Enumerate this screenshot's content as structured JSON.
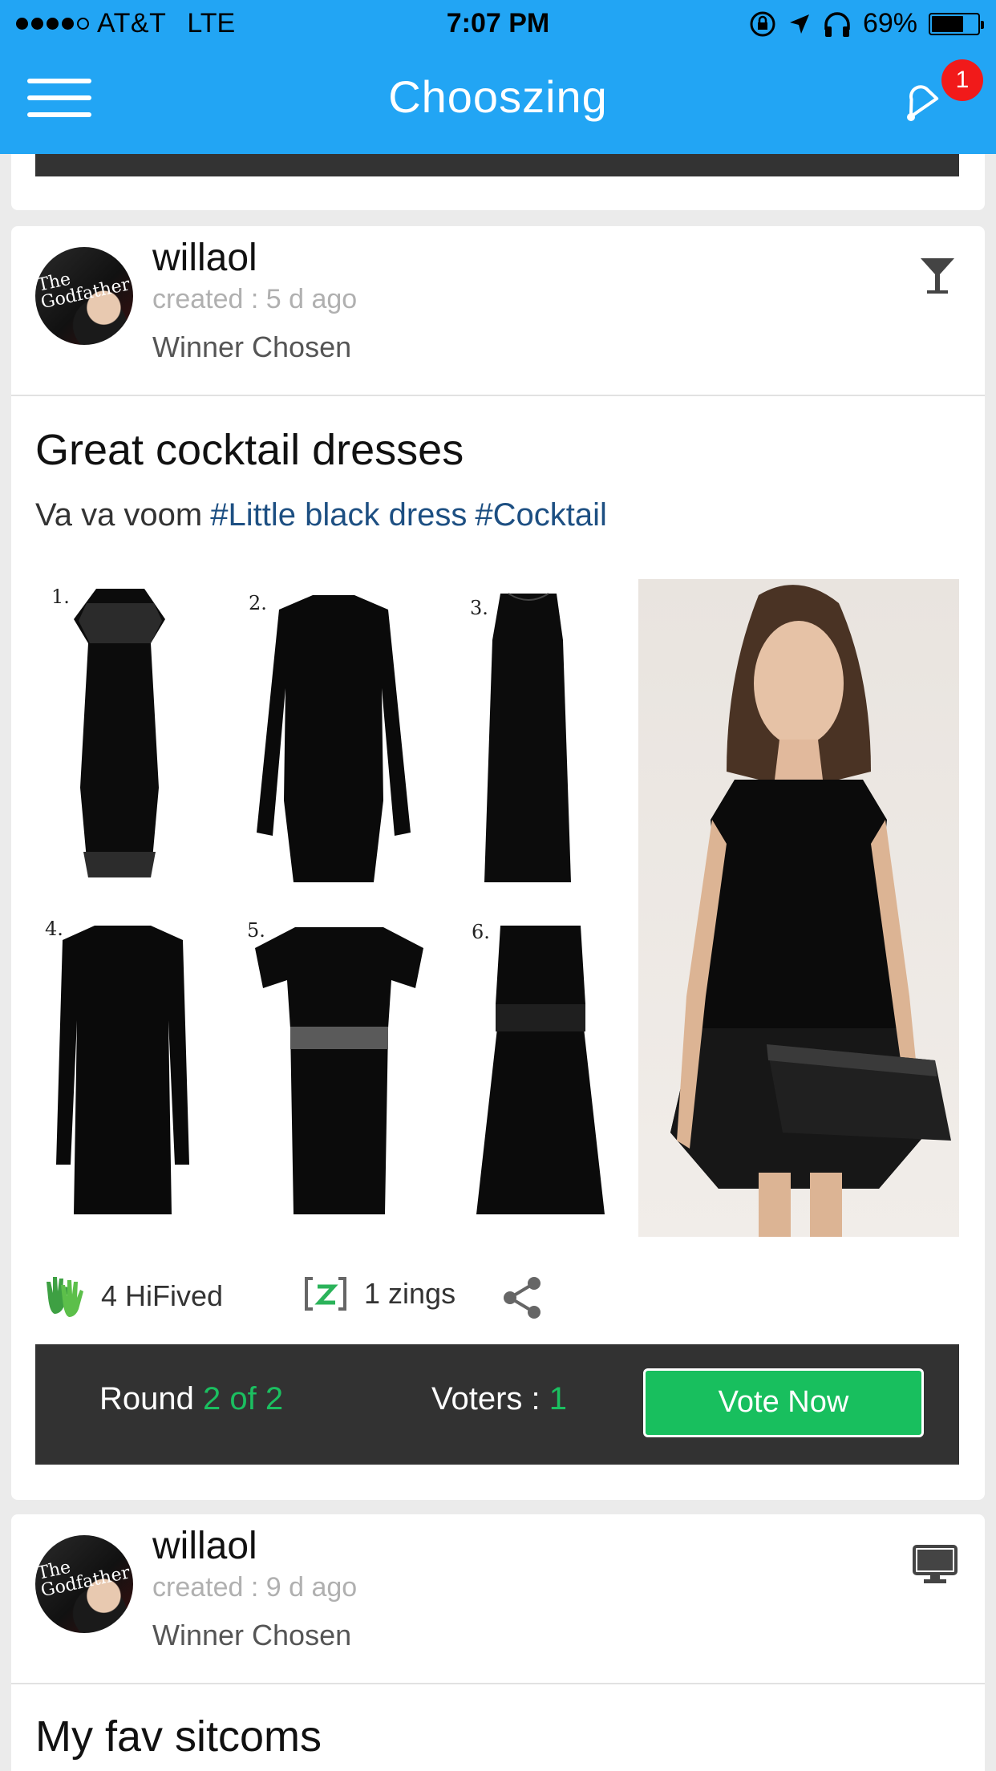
{
  "status_bar": {
    "carrier": "AT&T",
    "network": "LTE",
    "time": "7:07 PM",
    "battery": "69%",
    "battery_level": 0.69,
    "icons": [
      "orientation-lock-icon",
      "location-arrow-icon",
      "headphones-icon",
      "battery-icon"
    ]
  },
  "nav": {
    "title": "Chooszing",
    "menu_icon": "hamburger-menu-icon",
    "notification_icon": "bell-icon",
    "notification_count": "1"
  },
  "colors": {
    "nav_bg": "#22a5f4",
    "accent_green": "#1bbf60",
    "hashtag_blue": "#1d4f82",
    "badge_red": "#f11a1a",
    "vote_bar_bg": "#323232"
  },
  "posts": [
    {
      "user": "willaol",
      "created": "created : 5 d ago",
      "status": "Winner Chosen",
      "type_icon": "cocktail-glass-icon",
      "title": "Great cocktail dresses",
      "description": "Va va voom",
      "hashtags": [
        "#Little black dress",
        "#Cocktail"
      ],
      "collage_numbers": [
        "1.",
        "2.",
        "3.",
        "4.",
        "5.",
        "6."
      ],
      "hifived": "4 HiFived",
      "zings": "1 zings",
      "round_label": "Round",
      "round_value": "2 of 2",
      "voters_label": "Voters :",
      "voters_value": "1",
      "vote_button": "Vote Now"
    },
    {
      "user": "willaol",
      "created": "created : 9 d ago",
      "status": "Winner Chosen",
      "type_icon": "monitor-icon",
      "title": "My fav sitcoms"
    }
  ]
}
